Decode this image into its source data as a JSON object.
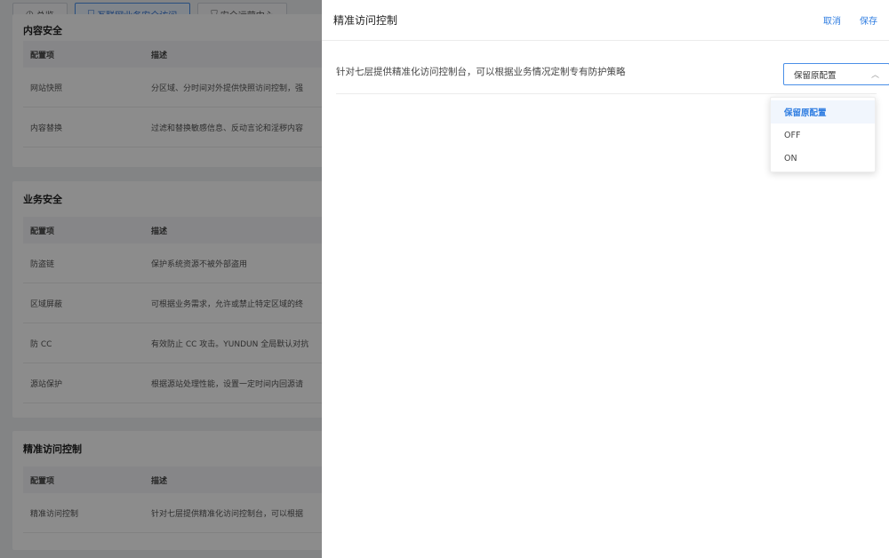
{
  "tabs": [
    {
      "icon": "dashboard-icon",
      "label": "总览"
    },
    {
      "icon": "shield-link-icon",
      "label": "互联网业务安全访问"
    },
    {
      "icon": "shield-check-icon",
      "label": "安全运营中心"
    }
  ],
  "sections": {
    "content": {
      "title": "内容安全",
      "header": {
        "col1": "配置项",
        "col2": "描述"
      },
      "rows": [
        {
          "item": "网站快照",
          "desc": "分区域、分时间对外提供快照访问控制，强"
        },
        {
          "item": "内容替换",
          "desc": "过滤和替换敏感信息、反动言论和淫秽内容"
        }
      ]
    },
    "business": {
      "title": "业务安全",
      "header": {
        "col1": "配置项",
        "col2": "描述"
      },
      "rows": [
        {
          "item": "防盗链",
          "desc": "保护系统资源不被外部盗用"
        },
        {
          "item": "区域屏蔽",
          "desc": "可根据业务需求，允许或禁止特定区域的终"
        },
        {
          "item": "防 CC",
          "desc": "有效防止 CC 攻击。YUNDUN 全局默认对抗"
        },
        {
          "item": "源站保护",
          "desc": "根据源站处理性能，设置一定时间内回源请"
        }
      ]
    },
    "access": {
      "title": "精准访问控制",
      "header": {
        "col1": "配置项",
        "col2": "描述"
      },
      "rows": [
        {
          "item": "精准访问控制",
          "desc": "针对七层提供精准化访问控制台，可以根据"
        }
      ]
    }
  },
  "drawer": {
    "title": "精准访问控制",
    "cancel_label": "取消",
    "save_label": "保存",
    "description": "针对七层提供精准化访问控制台，可以根据业务情况定制专有防护策略",
    "select": {
      "value": "保留原配置",
      "options": [
        "保留原配置",
        "OFF",
        "ON"
      ]
    }
  },
  "colors": {
    "accent": "#2f7de1",
    "overlay": "rgba(0,0,0,0.45)"
  }
}
